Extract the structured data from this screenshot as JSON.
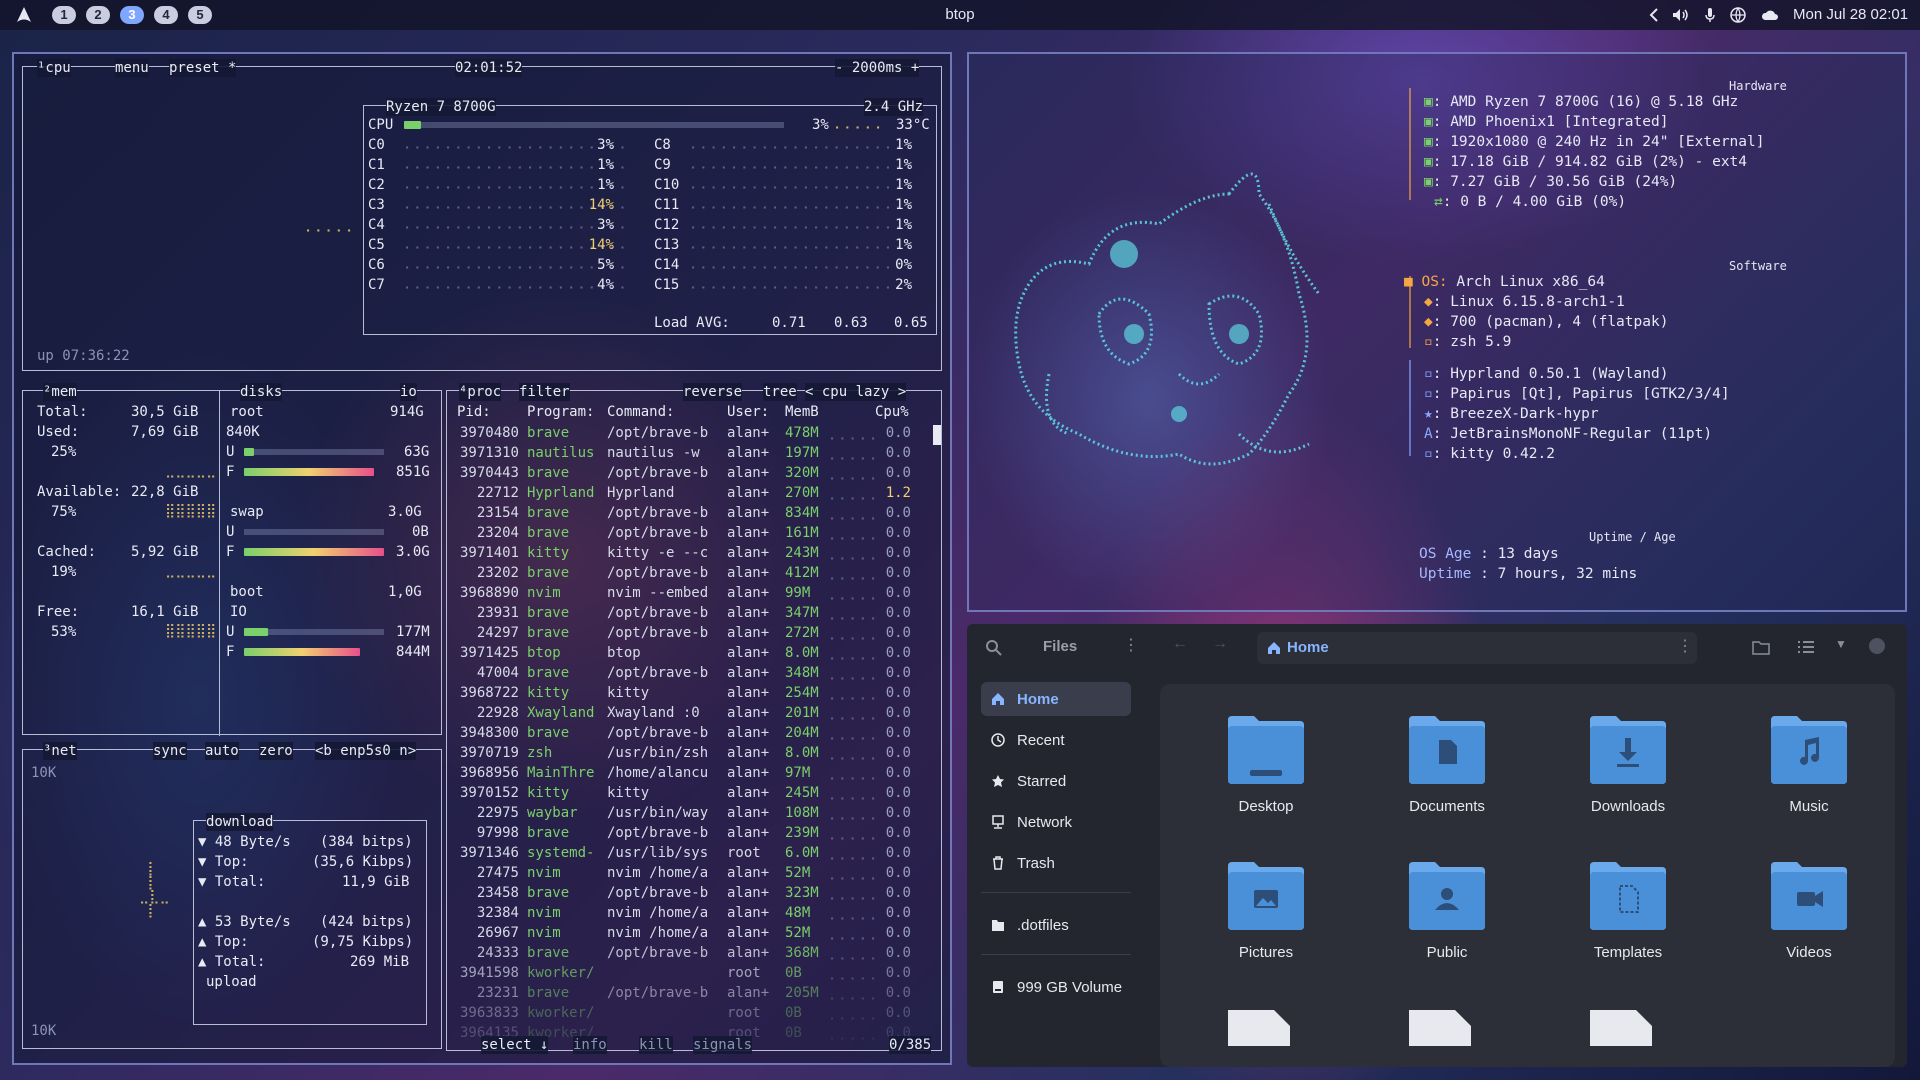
{
  "topbar": {
    "workspaces": [
      "1",
      "2",
      "3",
      "4",
      "5"
    ],
    "active_workspace": "3",
    "window_title": "btop",
    "clock": "Mon Jul 28 02:01",
    "tray_icons": [
      "chevron-left-icon",
      "volume-icon",
      "microphone-icon",
      "network-icon",
      "cloud-icon"
    ]
  },
  "btop": {
    "cpu": {
      "header_label": "¹cpu",
      "menu_label": "menu",
      "preset_label": "preset *",
      "clock": "02:01:52",
      "interval": "- 2000ms +",
      "model": "Ryzen 7 8700G",
      "freq": "2.4 GHz",
      "total_label": "CPU",
      "total_pct": "3%",
      "temp": "33°C",
      "total_pct_value": 3,
      "cores_left": [
        {
          "name": "C0",
          "pct": "3%",
          "value": 3
        },
        {
          "name": "C1",
          "pct": "1%",
          "value": 1
        },
        {
          "name": "C2",
          "pct": "1%",
          "value": 1
        },
        {
          "name": "C3",
          "pct": "14%",
          "value": 14
        },
        {
          "name": "C4",
          "pct": "3%",
          "value": 3
        },
        {
          "name": "C5",
          "pct": "14%",
          "value": 14
        },
        {
          "name": "C6",
          "pct": "5%",
          "value": 5
        },
        {
          "name": "C7",
          "pct": "4%",
          "value": 4
        }
      ],
      "cores_right": [
        {
          "name": "C8",
          "pct": "1%",
          "value": 1
        },
        {
          "name": "C9",
          "pct": "1%",
          "value": 1
        },
        {
          "name": "C10",
          "pct": "1%",
          "value": 1
        },
        {
          "name": "C11",
          "pct": "1%",
          "value": 1
        },
        {
          "name": "C12",
          "pct": "1%",
          "value": 1
        },
        {
          "name": "C13",
          "pct": "1%",
          "value": 1
        },
        {
          "name": "C14",
          "pct": "0%",
          "value": 0
        },
        {
          "name": "C15",
          "pct": "2%",
          "value": 2
        }
      ],
      "load_label": "Load AVG:",
      "load_values": [
        "0.71",
        "0.63",
        "0.65"
      ],
      "uptime": "up 07:36:22"
    },
    "mem": {
      "header": "²mem",
      "total_label": "Total:",
      "total": "30,5 GiB",
      "used_label": "Used:",
      "used": "7,69 GiB",
      "used_pct": "25%",
      "avail_label": "Available:",
      "avail": "22,8 GiB",
      "avail_pct": "75%",
      "cached_label": "Cached:",
      "cached": "5,92 GiB",
      "cached_pct": "19%",
      "free_label": "Free:",
      "free": "16,1 GiB",
      "free_pct": "53%"
    },
    "disks": {
      "header": "disks",
      "io_label": "io",
      "root_label": "root",
      "root_size": "914G",
      "root_io": "840K",
      "root_u": "63G",
      "root_f": "851G",
      "root_u_frac": 0.07,
      "root_f_frac": 0.93,
      "swap_label": "swap",
      "swap_size": "3.0G",
      "swap_u": "0B",
      "swap_f": "3.0G",
      "swap_u_frac": 0.0,
      "swap_f_frac": 1.0,
      "boot_label": "boot",
      "boot_size": "1,0G",
      "boot_io": "IO",
      "boot_u": "177M",
      "boot_f": "844M",
      "boot_u_frac": 0.17,
      "boot_f_frac": 0.83,
      "u_letter": "U",
      "f_letter": "F"
    },
    "net": {
      "header": "³net",
      "sync": "sync",
      "auto": "auto",
      "zero": "zero",
      "iface": "<b enp5s0 n>",
      "scale_top": "10K",
      "scale_bottom": "10K",
      "download_label": "download",
      "dl_rate": "▼ 48 Byte/s",
      "dl_bits": "(384 bitps)",
      "dl_top_label": "▼ Top:",
      "dl_top": "(35,6 Kibps)",
      "dl_total_label": "▼ Total:",
      "dl_total": "11,9 GiB",
      "ul_rate": "▲ 53 Byte/s",
      "ul_bits": "(424 bitps)",
      "ul_top_label": "▲ Top:",
      "ul_top": "(9,75 Kibps)",
      "ul_total_label": "▲ Total:",
      "ul_total": "269 MiB",
      "upload_label": "upload"
    },
    "proc": {
      "header": "⁴proc",
      "filter": "filter",
      "reverse": "reverse",
      "tree": "tree",
      "sort": "< cpu lazy >",
      "columns": {
        "pid": "Pid:",
        "program": "Program:",
        "command": "Command:",
        "user": "User:",
        "mem": "MemB",
        "cpu": "Cpu%"
      },
      "rows": [
        {
          "pid": "3970480",
          "program": "brave",
          "command": "/opt/brave-b",
          "user": "alan+",
          "mem": "478M",
          "cpu": "0.0"
        },
        {
          "pid": "3971310",
          "program": "nautilus",
          "command": "nautilus -w",
          "user": "alan+",
          "mem": "197M",
          "cpu": "0.0"
        },
        {
          "pid": "3970443",
          "program": "brave",
          "command": "/opt/brave-b",
          "user": "alan+",
          "mem": "320M",
          "cpu": "0.0"
        },
        {
          "pid": "22712",
          "program": "Hyprland",
          "command": "Hyprland",
          "user": "alan+",
          "mem": "270M",
          "cpu": "1.2"
        },
        {
          "pid": "23154",
          "program": "brave",
          "command": "/opt/brave-b",
          "user": "alan+",
          "mem": "834M",
          "cpu": "0.0"
        },
        {
          "pid": "23204",
          "program": "brave",
          "command": "/opt/brave-b",
          "user": "alan+",
          "mem": "161M",
          "cpu": "0.0"
        },
        {
          "pid": "3971401",
          "program": "kitty",
          "command": "kitty -e --c",
          "user": "alan+",
          "mem": "243M",
          "cpu": "0.0"
        },
        {
          "pid": "23202",
          "program": "brave",
          "command": "/opt/brave-b",
          "user": "alan+",
          "mem": "412M",
          "cpu": "0.0"
        },
        {
          "pid": "3968890",
          "program": "nvim",
          "command": "nvim --embed",
          "user": "alan+",
          "mem": "99M",
          "cpu": "0.0"
        },
        {
          "pid": "23931",
          "program": "brave",
          "command": "/opt/brave-b",
          "user": "alan+",
          "mem": "347M",
          "cpu": "0.0"
        },
        {
          "pid": "24297",
          "program": "brave",
          "command": "/opt/brave-b",
          "user": "alan+",
          "mem": "272M",
          "cpu": "0.0"
        },
        {
          "pid": "3971425",
          "program": "btop",
          "command": "btop",
          "user": "alan+",
          "mem": "8.0M",
          "cpu": "0.0"
        },
        {
          "pid": "47004",
          "program": "brave",
          "command": "/opt/brave-b",
          "user": "alan+",
          "mem": "348M",
          "cpu": "0.0"
        },
        {
          "pid": "3968722",
          "program": "kitty",
          "command": "kitty",
          "user": "alan+",
          "mem": "254M",
          "cpu": "0.0"
        },
        {
          "pid": "22928",
          "program": "Xwayland",
          "command": "Xwayland :0",
          "user": "alan+",
          "mem": "201M",
          "cpu": "0.0"
        },
        {
          "pid": "3948300",
          "program": "brave",
          "command": "/opt/brave-b",
          "user": "alan+",
          "mem": "204M",
          "cpu": "0.0"
        },
        {
          "pid": "3970719",
          "program": "zsh",
          "command": "/usr/bin/zsh",
          "user": "alan+",
          "mem": "8.0M",
          "cpu": "0.0"
        },
        {
          "pid": "3968956",
          "program": "MainThre",
          "command": "/home/alancu",
          "user": "alan+",
          "mem": "97M",
          "cpu": "0.0"
        },
        {
          "pid": "3970152",
          "program": "kitty",
          "command": "kitty",
          "user": "alan+",
          "mem": "245M",
          "cpu": "0.0"
        },
        {
          "pid": "22975",
          "program": "waybar",
          "command": "/usr/bin/way",
          "user": "alan+",
          "mem": "108M",
          "cpu": "0.0"
        },
        {
          "pid": "97998",
          "program": "brave",
          "command": "/opt/brave-b",
          "user": "alan+",
          "mem": "239M",
          "cpu": "0.0"
        },
        {
          "pid": "3971346",
          "program": "systemd-",
          "command": "/usr/lib/sys",
          "user": "root",
          "mem": "6.0M",
          "cpu": "0.0"
        },
        {
          "pid": "27475",
          "program": "nvim",
          "command": "nvim /home/a",
          "user": "alan+",
          "mem": "52M",
          "cpu": "0.0"
        },
        {
          "pid": "23458",
          "program": "brave",
          "command": "/opt/brave-b",
          "user": "alan+",
          "mem": "323M",
          "cpu": "0.0"
        },
        {
          "pid": "32384",
          "program": "nvim",
          "command": "nvim /home/a",
          "user": "alan+",
          "mem": "48M",
          "cpu": "0.0"
        },
        {
          "pid": "26967",
          "program": "nvim",
          "command": "nvim /home/a",
          "user": "alan+",
          "mem": "52M",
          "cpu": "0.0"
        },
        {
          "pid": "24333",
          "program": "brave",
          "command": "/opt/brave-b",
          "user": "alan+",
          "mem": "368M",
          "cpu": "0.0"
        },
        {
          "pid": "3941598",
          "program": "kworker/",
          "command": "",
          "user": "root",
          "mem": "0B",
          "cpu": "0.0"
        },
        {
          "pid": "23231",
          "program": "brave",
          "command": "/opt/brave-b",
          "user": "alan+",
          "mem": "205M",
          "cpu": "0.0"
        },
        {
          "pid": "3963833",
          "program": "kworker/",
          "command": "",
          "user": "root",
          "mem": "0B",
          "cpu": "0.0"
        },
        {
          "pid": "3964135",
          "program": "kworker/",
          "command": "",
          "user": "root",
          "mem": "0B",
          "cpu": "0.0"
        }
      ],
      "select": "select ↓",
      "info": "info",
      "kill": "kill",
      "signals": "signals",
      "count": "0/385"
    }
  },
  "fastfetch": {
    "hardware_header": "Hardware",
    "hardware": [
      {
        "icon": "cpu-icon",
        "text": ": AMD Ryzen 7 8700G (16) @ 5.18 GHz"
      },
      {
        "icon": "gpu-icon",
        "text": ": AMD Phoenix1 [Integrated]"
      },
      {
        "icon": "monitor-icon",
        "text": ": 1920x1080 @ 240 Hz in 24\" [External]"
      },
      {
        "icon": "disk-icon",
        "text": ": 17.18 GiB / 914.82 GiB (2%) - ext4"
      },
      {
        "icon": "memory-icon",
        "text": ": 7.27 GiB / 30.56 GiB (24%)"
      },
      {
        "icon": "swap-icon",
        "text": ": 0 B / 4.00 GiB (0%)"
      }
    ],
    "software_header": "Software",
    "os_key": "OS:",
    "os": " Arch Linux x86_64",
    "software": [
      {
        "icon": "kernel-icon",
        "text": ": Linux 6.15.8-arch1-1"
      },
      {
        "icon": "package-icon",
        "text": ": 700 (pacman), 4 (flatpak)"
      },
      {
        "icon": "shell-icon",
        "text": ": zsh 5.9"
      }
    ],
    "desktop": [
      {
        "icon": "wm-icon",
        "text": ": Hyprland 0.50.1 (Wayland)"
      },
      {
        "icon": "theme-icon",
        "text": ": Papirus [Qt], Papirus [GTK2/3/4]"
      },
      {
        "icon": "cursor-icon",
        "text": ": BreezeX-Dark-hypr"
      },
      {
        "icon": "font-icon",
        "text": ": JetBrainsMonoNF-Regular (11pt)"
      },
      {
        "icon": "terminal-icon",
        "text": ": kitty 0.42.2"
      }
    ],
    "age_header": "Uptime / Age",
    "os_age_key": "OS Age",
    "os_age": " : 13 days",
    "uptime_key": "Uptime",
    "uptime": " : 7 hours, 32 mins"
  },
  "files": {
    "title": "Files",
    "location": "Home",
    "sidebar": [
      {
        "label": "Home",
        "icon": "home-icon",
        "active": true
      },
      {
        "label": "Recent",
        "icon": "clock-icon",
        "active": false
      },
      {
        "label": "Starred",
        "icon": "star-icon",
        "active": false
      },
      {
        "label": "Network",
        "icon": "network-icon",
        "active": false
      },
      {
        "label": "Trash",
        "icon": "trash-icon",
        "active": false
      }
    ],
    "bookmarks": [
      {
        "label": ".dotfiles",
        "icon": "folder-icon"
      }
    ],
    "volumes": [
      {
        "label": "999 GB Volume",
        "icon": "drive-icon"
      }
    ],
    "folders": [
      {
        "label": "Desktop",
        "icon": "desktop-folder-icon"
      },
      {
        "label": "Documents",
        "icon": "documents-folder-icon"
      },
      {
        "label": "Downloads",
        "icon": "downloads-folder-icon"
      },
      {
        "label": "Music",
        "icon": "music-folder-icon"
      },
      {
        "label": "Pictures",
        "icon": "pictures-folder-icon"
      },
      {
        "label": "Public",
        "icon": "public-folder-icon"
      },
      {
        "label": "Templates",
        "icon": "templates-folder-icon"
      },
      {
        "label": "Videos",
        "icon": "videos-folder-icon"
      }
    ],
    "colors": {
      "folder": "#4a90d9",
      "folder_tab": "#6aa9ec",
      "accent": "#87b5ff"
    }
  },
  "colors": {
    "btop_border": "#6f77b8",
    "green": "#7ad06a",
    "orange": "#f5a742",
    "cyan": "#5ed4e0",
    "pink": "#e7508a"
  }
}
